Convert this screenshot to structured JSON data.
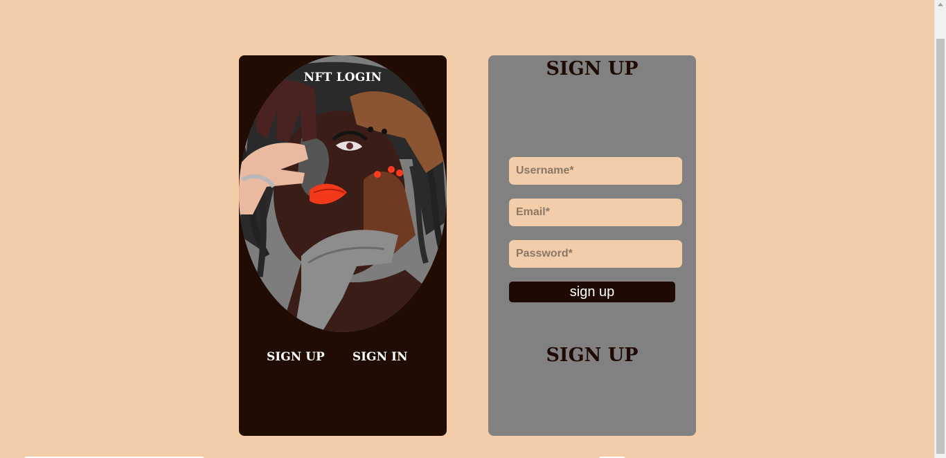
{
  "colors": {
    "page_background": "#f3cca9",
    "left_card_background": "#200c02",
    "right_card_background": "#818181",
    "input_background": "#f3cca9",
    "button_background": "#1e0a02",
    "button_text": "#ffffff"
  },
  "left_card": {
    "title": "NFT LOGIN",
    "nav": {
      "signup_label": "SIGN UP",
      "signin_label": "SIGN IN"
    }
  },
  "right_card": {
    "title": "SIGN UP",
    "fields": {
      "username_placeholder": "Username*",
      "email_placeholder": "Email*",
      "password_placeholder": "Password*"
    },
    "submit_label": "sign up",
    "footer_label": "SIGN UP"
  }
}
